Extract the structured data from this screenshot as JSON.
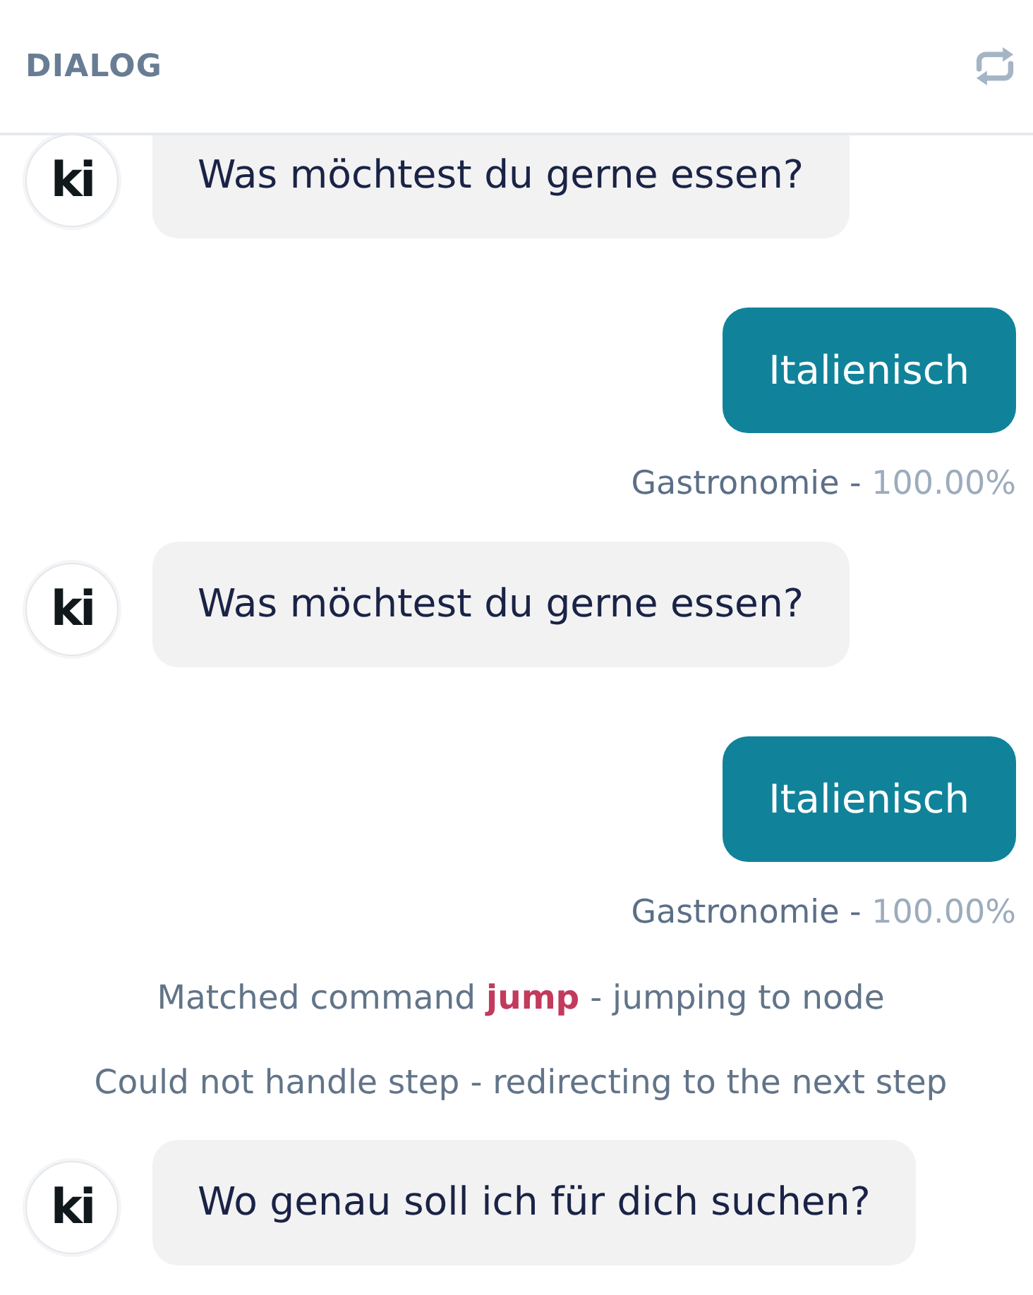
{
  "header": {
    "title": "DIALOG"
  },
  "messages": [
    {
      "kind": "bot",
      "avatar": "ki",
      "text": "Was möchtest du gerne essen?"
    },
    {
      "kind": "user",
      "text": "Italienisch",
      "intent": "Gastronomie -",
      "score": "100.00%"
    },
    {
      "kind": "bot",
      "avatar": "ki",
      "text": "Was möchtest du gerne essen?"
    },
    {
      "kind": "user",
      "text": "Italienisch",
      "intent": "Gastronomie -",
      "score": "100.00%"
    },
    {
      "kind": "system",
      "text": "Matched command **jump** - jumping to node"
    },
    {
      "kind": "system",
      "text": "Could not handle step - redirecting to the next step"
    },
    {
      "kind": "bot",
      "avatar": "ki",
      "text": "Wo genau soll ich für dich suchen?"
    }
  ]
}
